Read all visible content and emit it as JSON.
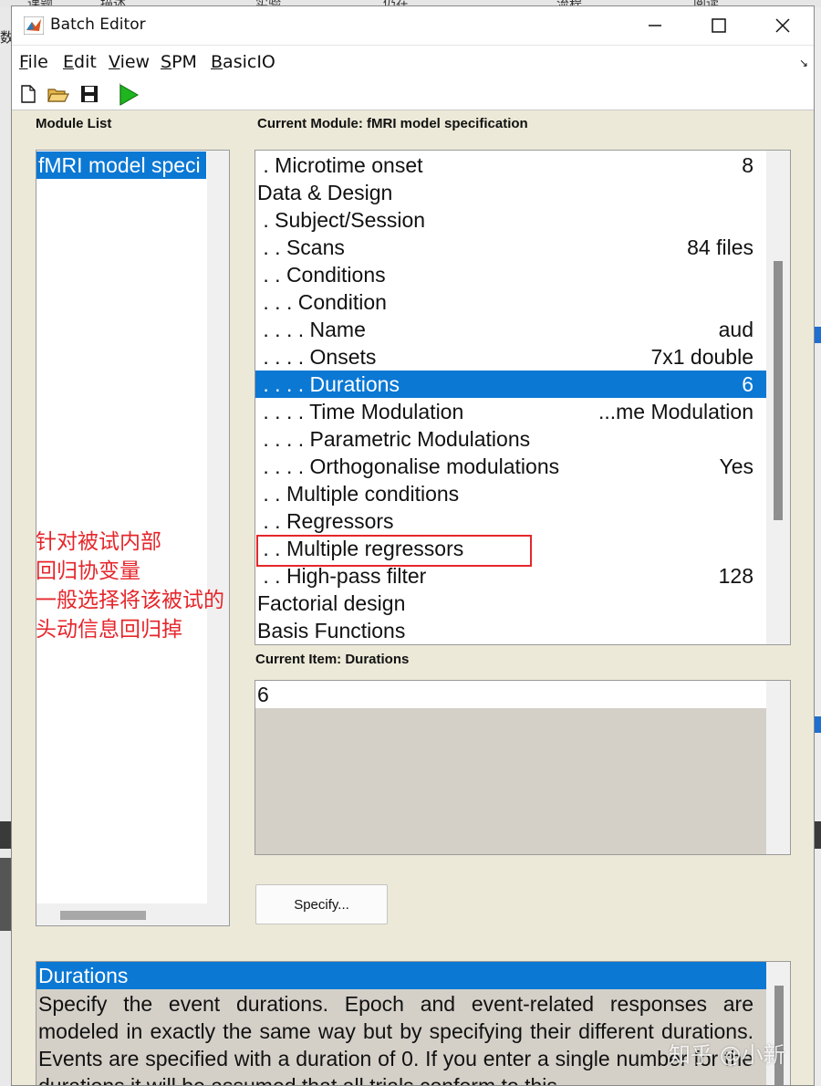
{
  "background": {
    "top_strip": [
      "课题",
      "描述",
      "实验",
      "仍在",
      "流程",
      "阅读"
    ],
    "left_text": "数"
  },
  "window": {
    "title": "Batch Editor",
    "minimize_label": "minimize",
    "maximize_label": "maximize",
    "close_label": "close"
  },
  "menubar": {
    "items": [
      {
        "u": "F",
        "rest": "ile"
      },
      {
        "u": "E",
        "rest": "dit"
      },
      {
        "u": "V",
        "rest": "iew"
      },
      {
        "u": "S",
        "rest": "PM"
      },
      {
        "u": "B",
        "rest": "asicIO"
      }
    ]
  },
  "toolbar": {
    "icons": [
      "new-file-icon",
      "open-folder-icon",
      "save-icon",
      "run-icon"
    ]
  },
  "module_list": {
    "heading": "Module List",
    "items": [
      "fMRI model speci"
    ]
  },
  "current_module": {
    "heading": "Current Module: fMRI model specification",
    "rows": [
      {
        "label": " . Microtime onset",
        "value": "8"
      },
      {
        "label": "Data & Design",
        "value": ""
      },
      {
        "label": " . Subject/Session",
        "value": ""
      },
      {
        "label": " . . Scans",
        "value": "84 files"
      },
      {
        "label": " . . Conditions",
        "value": ""
      },
      {
        "label": " . . . Condition",
        "value": ""
      },
      {
        "label": " . . . . Name",
        "value": "aud"
      },
      {
        "label": " . . . . Onsets",
        "value": "7x1 double"
      },
      {
        "label": " . . . . Durations",
        "value": "6"
      },
      {
        "label": " . . . . Time Modulation",
        "value": "...me Modulation"
      },
      {
        "label": " . . . . Parametric Modulations",
        "value": ""
      },
      {
        "label": " . . . . Orthogonalise modulations",
        "value": "Yes"
      },
      {
        "label": " . . Multiple conditions",
        "value": ""
      },
      {
        "label": " . . Regressors",
        "value": ""
      },
      {
        "label": " . . Multiple regressors",
        "value": ""
      },
      {
        "label": " . . High-pass filter",
        "value": "128"
      },
      {
        "label": "Factorial design",
        "value": ""
      },
      {
        "label": "Basis Functions",
        "value": ""
      }
    ],
    "selected_index": 8
  },
  "annotation": {
    "lines": [
      "针对被试内部",
      "回归协变量",
      "一般选择将该被试的",
      "头动信息回归掉"
    ],
    "color": "#e5262b"
  },
  "current_item": {
    "heading": "Current Item: Durations",
    "value": "6"
  },
  "specify_button": "Specify...",
  "help": {
    "title": "Durations",
    "body": "Specify the event durations. Epoch and event-related responses are modeled in exactly the same way but by specifying their different durations.  Events are specified with a duration of 0.  If you enter a single number for the durations it will be assumed that all trials conform to this"
  },
  "watermark": "知乎 @小新",
  "colors": {
    "selection": "#0b78d4",
    "panel": "#ece9d8"
  }
}
